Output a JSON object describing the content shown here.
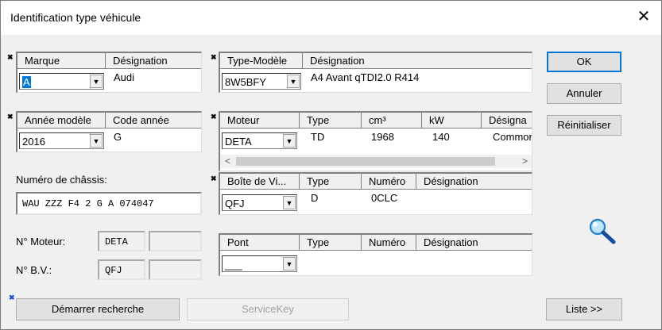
{
  "window": {
    "title": "Identification type véhicule",
    "close_glyph": "✕"
  },
  "marker": "✖",
  "marque": {
    "headers": [
      "Marque",
      "Désignation"
    ],
    "value": "A",
    "designation": "Audi"
  },
  "type_modele": {
    "headers": [
      "Type-Modèle",
      "Désignation"
    ],
    "value": "8W5BFY",
    "designation": "A4 Avant qTDI2.0 R414"
  },
  "annee": {
    "headers": [
      "Année modèle",
      "Code année"
    ],
    "value": "2016",
    "code": "G"
  },
  "moteur": {
    "headers": [
      "Moteur",
      "Type",
      "cm³",
      "kW",
      "Désigna"
    ],
    "value": "DETA",
    "type": "TD",
    "cm3": "1968",
    "kw": "140",
    "designation": "Commor"
  },
  "boite": {
    "headers": [
      "Boîte de Vi...",
      "Type",
      "Numéro",
      "Désignation"
    ],
    "value": "QFJ",
    "type": "D",
    "numero": "0CLC"
  },
  "pont": {
    "headers": [
      "Pont",
      "Type",
      "Numéro",
      "Désignation"
    ],
    "value": "___"
  },
  "chassis": {
    "label": "Numéro de châssis:",
    "value": "WAU ZZZ F4 2 G A 074047"
  },
  "no_moteur": {
    "label": "N° Moteur:",
    "value": "DETA"
  },
  "no_bv": {
    "label": "N° B.V.:",
    "value": "QFJ"
  },
  "buttons": {
    "ok": "OK",
    "annuler": "Annuler",
    "reinitialiser": "Réinitialiser",
    "demarrer": "Démarrer recherche",
    "servicekey": "ServiceKey",
    "liste": "Liste >>"
  },
  "icons": {
    "magnifier": "magnifier-icon",
    "dropdown": "chevron-down-icon"
  },
  "colors": {
    "focus_blue": "#0078d7",
    "marker_blue": "#1f4fd8"
  }
}
